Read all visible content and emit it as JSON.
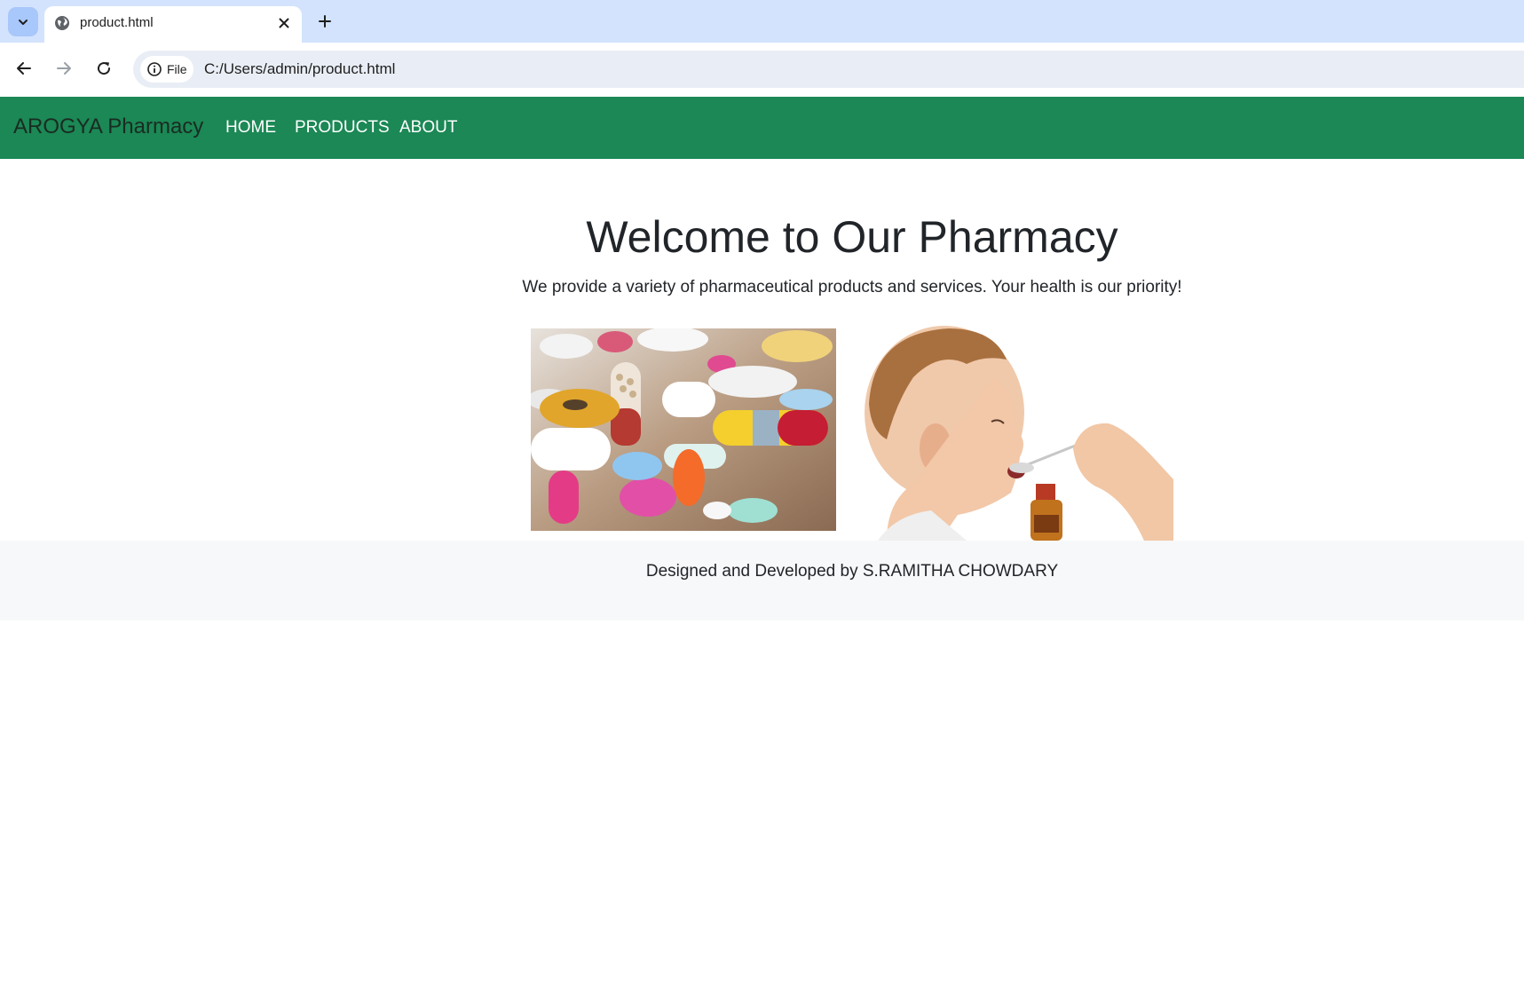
{
  "browser": {
    "tab_title": "product.html",
    "address_chip": "File",
    "url": "C:/Users/admin/product.html"
  },
  "navbar": {
    "brand": "AROGYA Pharmacy",
    "links": [
      "HOME",
      "PRODUCTS",
      "ABOUT"
    ],
    "background": "#1b8855"
  },
  "hero": {
    "title": "Welcome to Our Pharmacy",
    "subtitle": "We provide a variety of pharmaceutical products and services. Your health is our priority!"
  },
  "images": [
    {
      "name": "pills-photo"
    },
    {
      "name": "child-taking-medicine-photo"
    }
  ],
  "footer": {
    "text": "Designed and Developed by S.RAMITHA CHOWDARY"
  }
}
